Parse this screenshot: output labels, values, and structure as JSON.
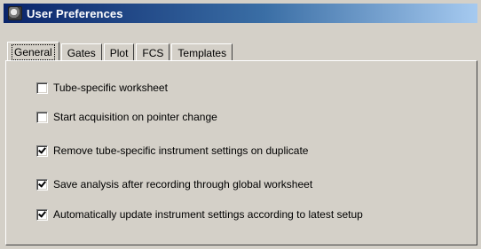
{
  "window": {
    "title": "User Preferences",
    "icon": "app-icon"
  },
  "tabs": [
    {
      "label": "General",
      "active": true
    },
    {
      "label": "Gates",
      "active": false
    },
    {
      "label": "Plot",
      "active": false
    },
    {
      "label": "FCS",
      "active": false
    },
    {
      "label": "Templates",
      "active": false
    }
  ],
  "options": [
    {
      "label": "Tube-specific worksheet",
      "checked": false
    },
    {
      "label": "Start acquisition on pointer change",
      "checked": false
    },
    {
      "label": "Remove tube-specific instrument settings on duplicate",
      "checked": true
    },
    {
      "label": "Save analysis after recording through global worksheet",
      "checked": true
    },
    {
      "label": "Automatically update instrument settings according to latest setup",
      "checked": true
    }
  ],
  "colors": {
    "titlebar_start": "#0a246a",
    "titlebar_end": "#a6caf0",
    "face": "#d4d0c8"
  }
}
